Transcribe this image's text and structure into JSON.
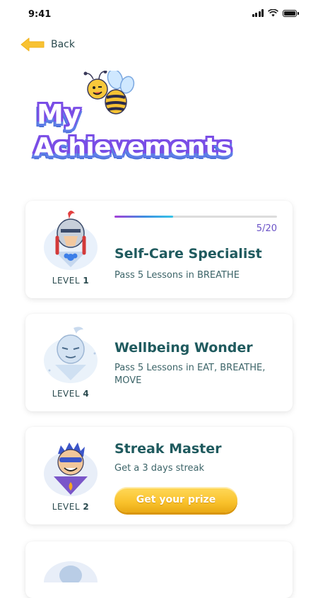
{
  "status": {
    "time": "9:41"
  },
  "nav": {
    "back_label": "Back"
  },
  "header": {
    "title_line1": "My",
    "title_line2": "Achievements"
  },
  "colors": {
    "accent_text": "#1f5a5e",
    "title_gradient_start": "#7a4de6",
    "button_gold": "#f9c22c",
    "progress_purple": "#a53fd8",
    "progress_blue": "#35c4e8"
  },
  "achievements": [
    {
      "title": "Self-Care Specialist",
      "description": "Pass 5 Lessons in BREATHE",
      "level_label": "LEVEL",
      "level": "1",
      "progress_text": "5/20",
      "progress_fraction": 0.36,
      "icon": "knight-avatar-icon"
    },
    {
      "title": "Wellbeing Wonder",
      "description": "Pass 5 Lessons in EAT, BREATHE, MOVE",
      "level_label": "LEVEL",
      "level": "4",
      "icon": "ghost-avatar-icon"
    },
    {
      "title": "Streak Master",
      "description": "Get a 3 days streak",
      "level_label": "LEVEL",
      "level": "2",
      "button_label": "Get your prize",
      "icon": "hero-avatar-icon"
    }
  ]
}
